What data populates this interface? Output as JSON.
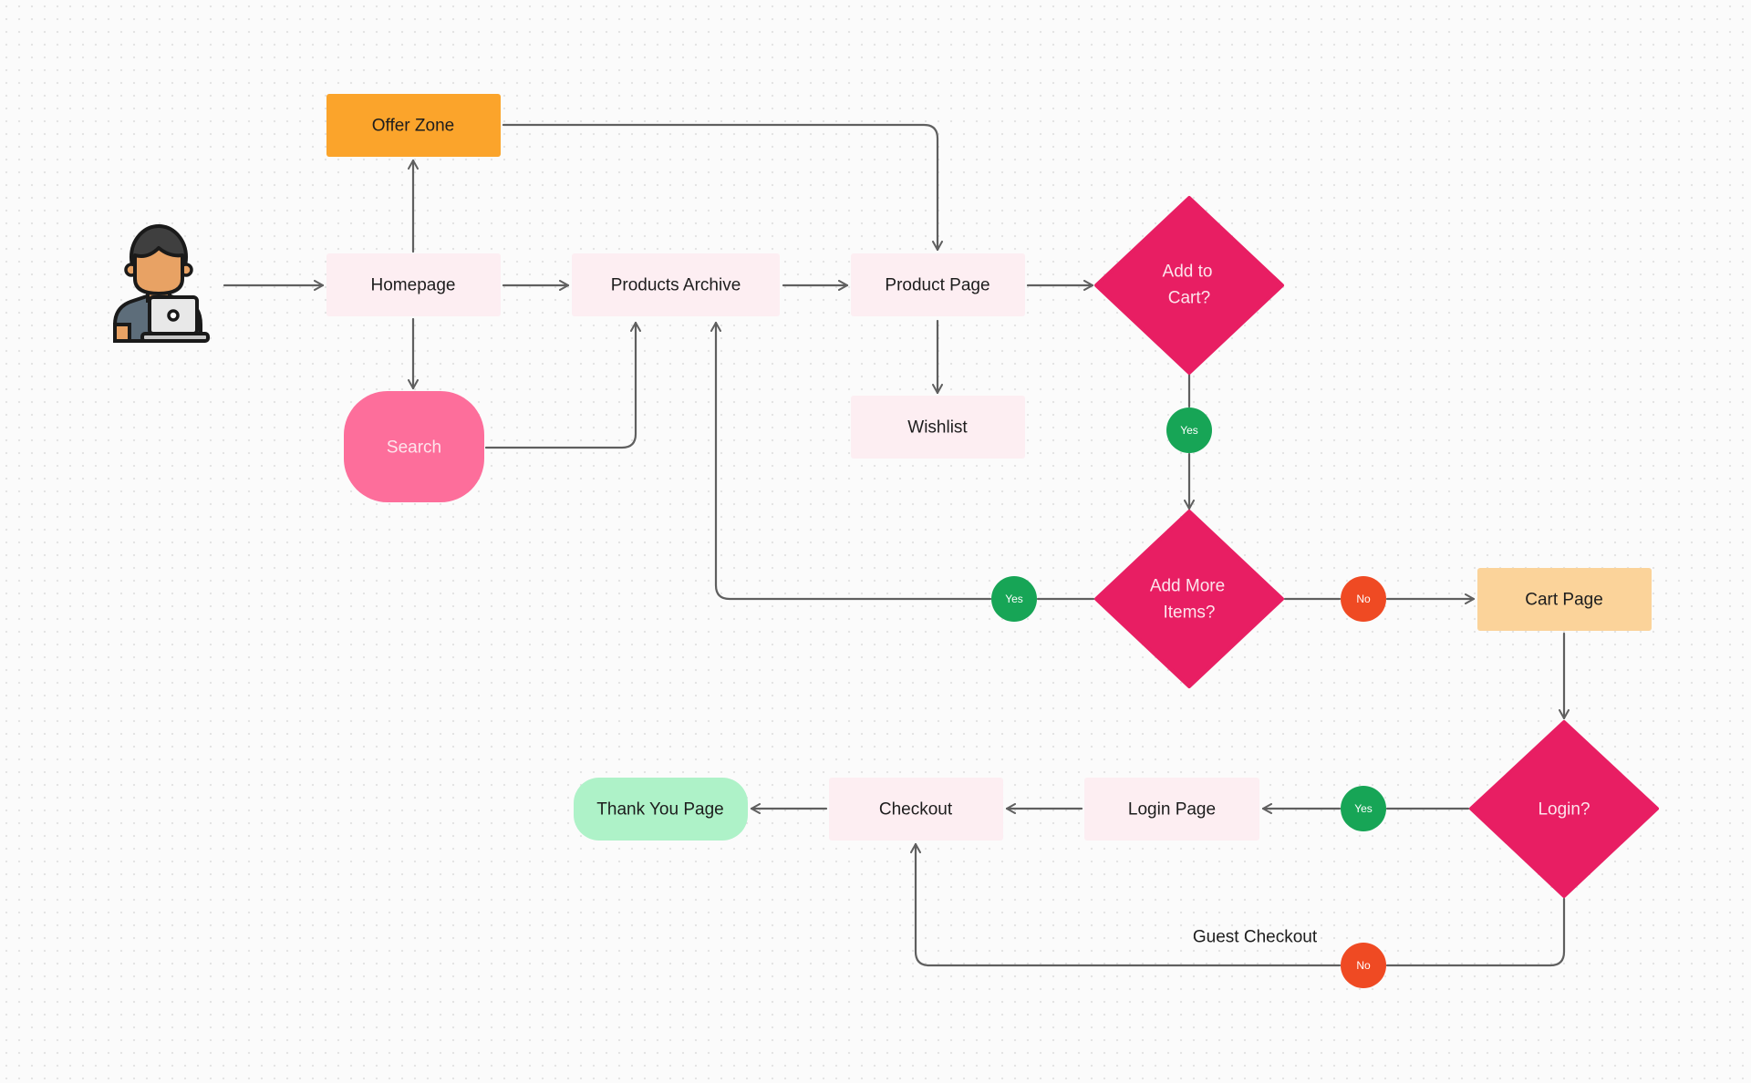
{
  "colors": {
    "page_box": "#fdeef2",
    "offer_zone": "#fba42b",
    "cart_page": "#fbd39a",
    "search": "#fd6e9b",
    "thank_you": "#aef2c8",
    "decision": "#e81e63",
    "yes": "#17a556",
    "no": "#ef4a23",
    "edge": "#5f5f5f"
  },
  "actor": {
    "icon": "user-with-laptop-icon"
  },
  "nodes": {
    "offer_zone": "Offer Zone",
    "homepage": "Homepage",
    "products_archive": "Products Archive",
    "product_page": "Product Page",
    "wishlist": "Wishlist",
    "search": "Search",
    "add_to_cart": [
      "Add to",
      "Cart?"
    ],
    "add_more_items": [
      "Add More",
      "Items?"
    ],
    "cart_page": "Cart Page",
    "login": "Login?",
    "login_page": "Login Page",
    "checkout": "Checkout",
    "thank_you_page": "Thank You Page"
  },
  "badges": {
    "add_to_cart_yes": "Yes",
    "add_more_yes": "Yes",
    "add_more_no": "No",
    "login_yes": "Yes",
    "login_no": "No"
  },
  "edge_labels": {
    "guest_checkout": "Guest Checkout"
  }
}
